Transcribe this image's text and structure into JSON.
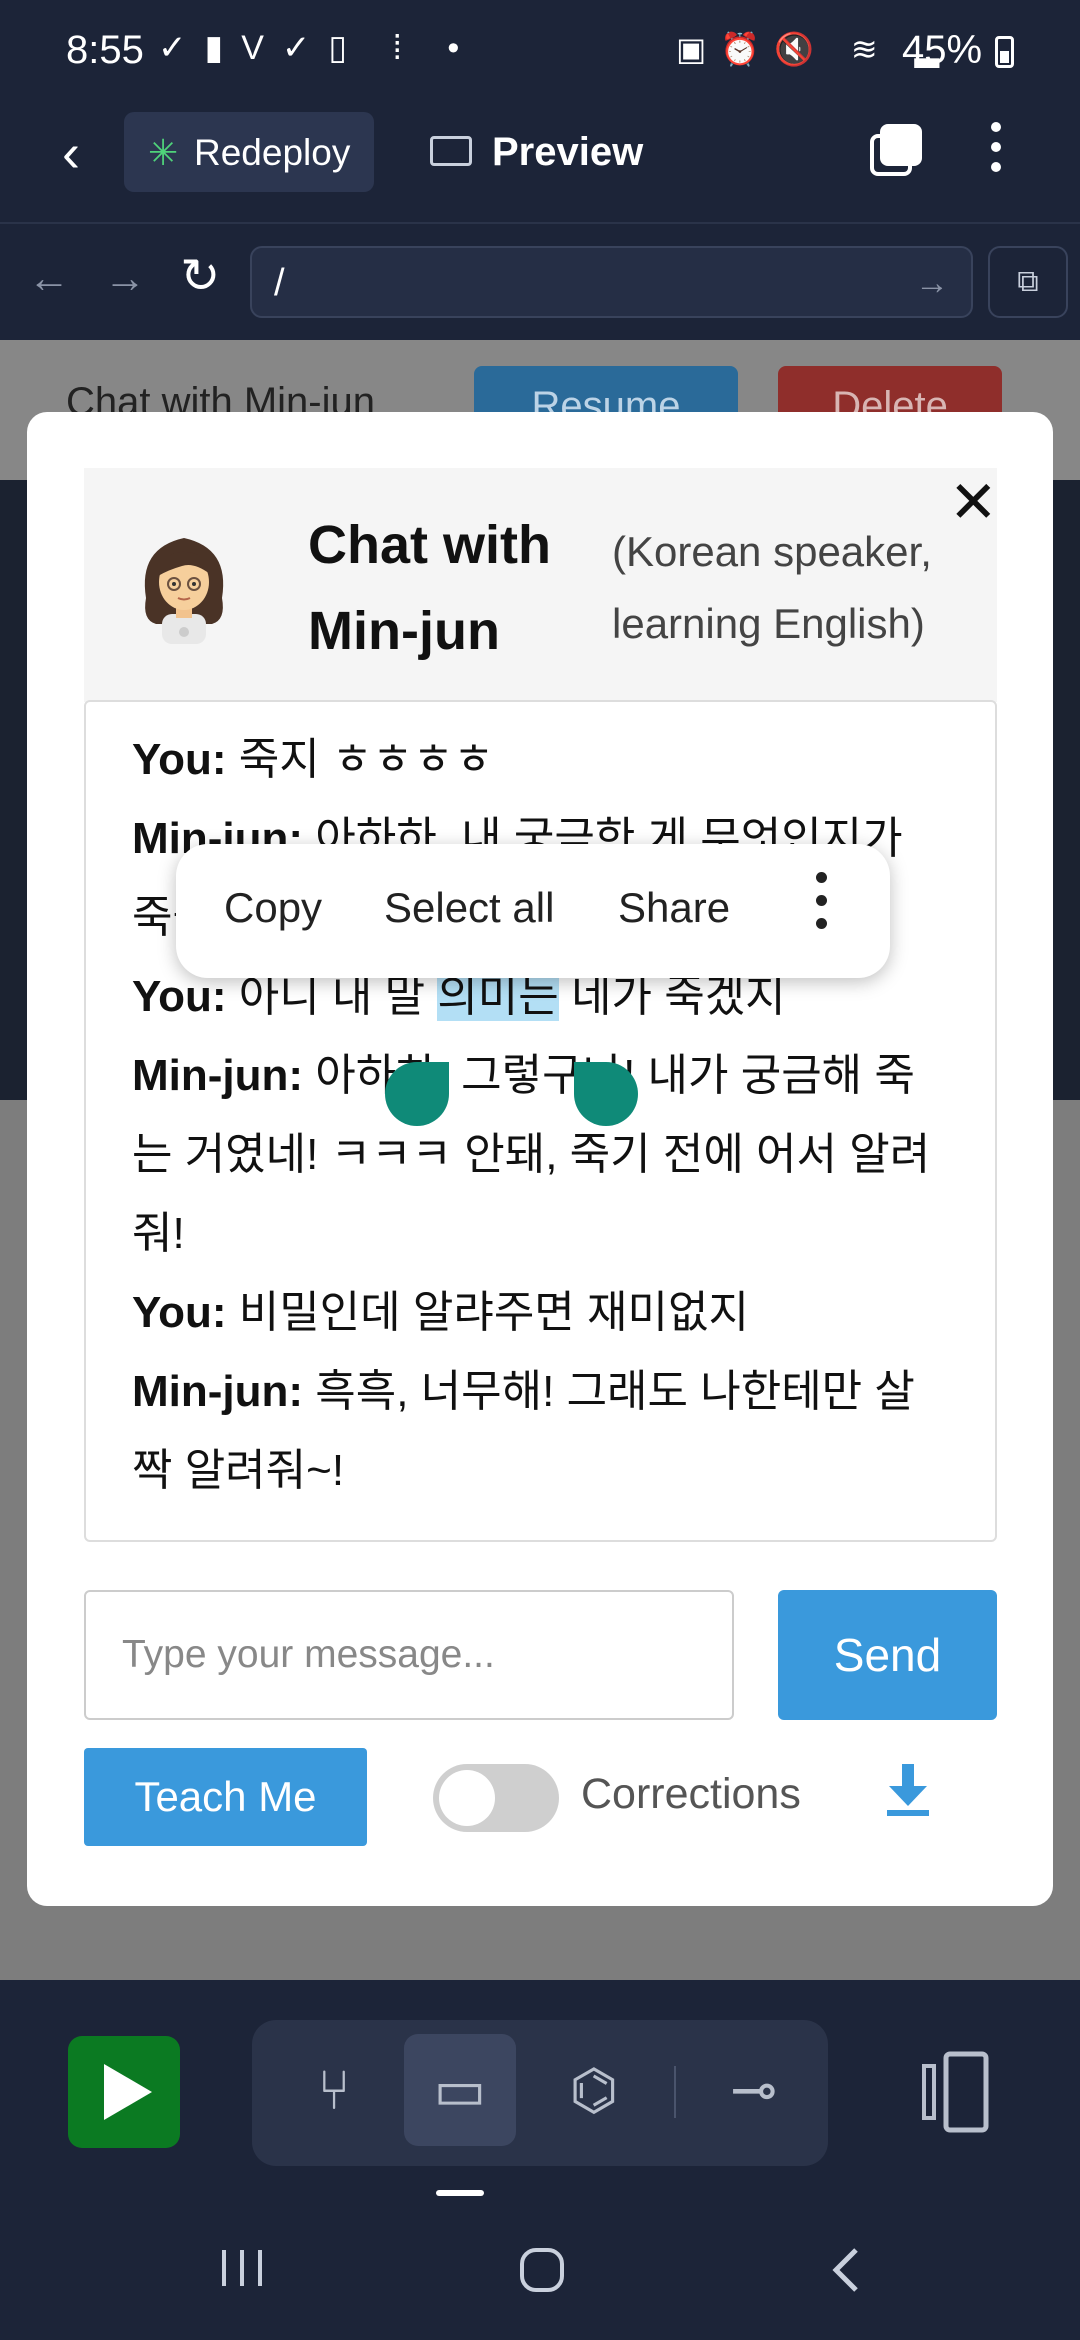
{
  "status_bar": {
    "time": "8:55",
    "battery": "45%",
    "left_icons": [
      "check-circle-icon",
      "cup-icon",
      "v-icon",
      "verified-icon",
      "phone-icon",
      "accessibility-icon",
      "dot-icon"
    ],
    "right_icons": [
      "battery-saver-icon",
      "alarm-icon",
      "mute-icon",
      "wifi-icon",
      "signal-icon"
    ]
  },
  "app_bar": {
    "redeploy_label": "Redeploy",
    "preview_label": "Preview"
  },
  "url_bar": {
    "url": "/"
  },
  "background_page": {
    "title": "Chat with Min-jun",
    "resume_label": "Resume",
    "delete_label": "Delete"
  },
  "modal": {
    "title": "Chat with Min-jun",
    "subtitle": "(Korean speaker, learning English)",
    "messages": [
      {
        "speaker": "You:",
        "text": " 죽지 ㅎㅎㅎㅎ"
      },
      {
        "speaker": "Min-jun:",
        "text": " 아하하, 내 궁금한 게 무엇인지가 죽을 만큼 궁금한 거야? 알려줘야 해!"
      },
      {
        "speaker": "You:",
        "text_before": " 아니 내 말 ",
        "selected": "의미는",
        "text_after": " 네가 죽겠지"
      },
      {
        "speaker": "Min-jun:",
        "text": " 아하하, 그렇구나! 내가 궁금해 죽는 거였네! ㅋㅋㅋ 안돼, 죽기 전에 어서 알려줘!"
      },
      {
        "speaker": "You:",
        "text": " 비밀인데 알랴주면 재미없지"
      },
      {
        "speaker": "Min-jun:",
        "text": " 흑흑, 너무해! 그래도 나한테만 살짝 알려줘~!"
      }
    ],
    "input_placeholder": "Type your message...",
    "send_label": "Send",
    "teach_label": "Teach Me",
    "corrections_label": "Corrections",
    "corrections_on": false
  },
  "selection_menu": {
    "copy": "Copy",
    "select_all": "Select all",
    "share": "Share"
  },
  "colors": {
    "primary": "#3a99dc",
    "run": "#0b7a22",
    "selection": "#b3dff5",
    "handle": "#0f8a78"
  }
}
